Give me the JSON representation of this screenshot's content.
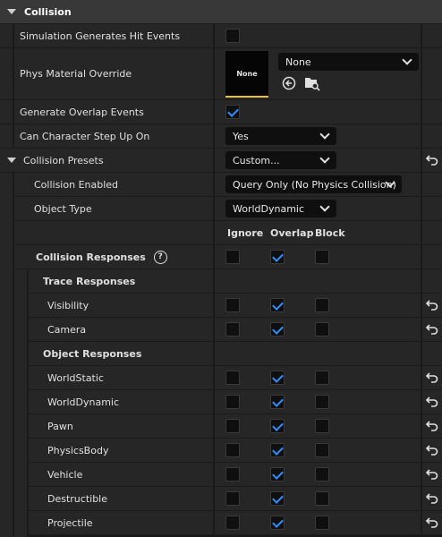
{
  "section": {
    "title": "Collision"
  },
  "props": {
    "sim_hit": "Simulation Generates Hit Events",
    "phys_mat": "Phys Material Override",
    "phys_mat_thumb": "None",
    "phys_mat_value": "None",
    "gen_overlap": "Generate Overlap Events",
    "step_up": "Can Character Step Up On",
    "step_up_value": "Yes",
    "presets": "Collision Presets",
    "presets_value": "Custom...",
    "collision_enabled": "Collision Enabled",
    "collision_enabled_value": "Query Only (No Physics Collision)",
    "object_type": "Object Type",
    "object_type_value": "WorldDynamic"
  },
  "columns": {
    "ignore": "Ignore",
    "overlap": "Overlap",
    "block": "Block"
  },
  "responses": {
    "title": "Collision Responses",
    "help": "?",
    "trace_title": "Trace Responses",
    "object_title": "Object Responses",
    "trace": [
      {
        "label": "Visibility",
        "ignore": false,
        "overlap": true,
        "block": false
      },
      {
        "label": "Camera",
        "ignore": false,
        "overlap": true,
        "block": false
      }
    ],
    "object": [
      {
        "label": "WorldStatic",
        "ignore": false,
        "overlap": true,
        "block": false
      },
      {
        "label": "WorldDynamic",
        "ignore": false,
        "overlap": true,
        "block": false
      },
      {
        "label": "Pawn",
        "ignore": false,
        "overlap": true,
        "block": false
      },
      {
        "label": "PhysicsBody",
        "ignore": false,
        "overlap": true,
        "block": false
      },
      {
        "label": "Vehicle",
        "ignore": false,
        "overlap": true,
        "block": false
      },
      {
        "label": "Destructible",
        "ignore": false,
        "overlap": true,
        "block": false
      },
      {
        "label": "Projectile",
        "ignore": false,
        "overlap": true,
        "block": false
      }
    ]
  },
  "states": {
    "sim_hit_checked": false,
    "gen_overlap_checked": true,
    "all_ignore": false,
    "all_overlap": true,
    "all_block": false
  },
  "colors": {
    "accent": "#2f8fff",
    "thumb_underline": "#e8c040"
  }
}
